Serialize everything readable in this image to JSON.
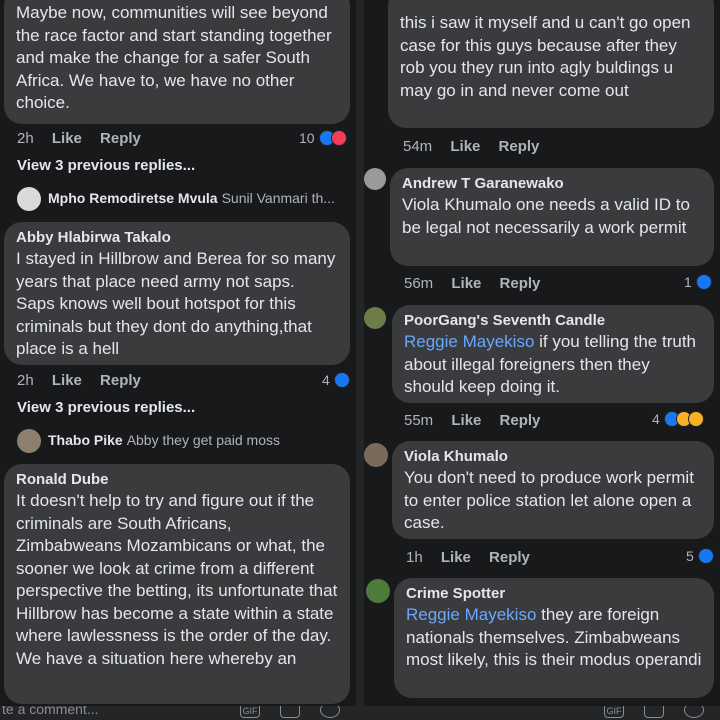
{
  "left": {
    "c1": {
      "text": "Maybe now, communities will see beyond the race factor and start standing together and make the change for a safer South Africa. We have to, we have no other choice.",
      "time": "2h",
      "like": "Like",
      "reply": "Reply",
      "count": "10",
      "view_replies": "View 3 previous replies...",
      "reply_name": "Mpho Remodiretse Mvula",
      "reply_text": "Sunil Vanmari th..."
    },
    "c2": {
      "name": "Abby Hlabirwa Takalo",
      "text": "I stayed in Hillbrow and Berea for so many years that place need army not saps. Saps knows well bout hotspot for this criminals but they dont do anything,that place is a hell",
      "time": "2h",
      "like": "Like",
      "reply": "Reply",
      "count": "4",
      "view_replies": "View 3 previous replies...",
      "reply_name": "Thabo Pike",
      "reply_text": "Abby they get paid moss"
    },
    "c3": {
      "name": "Ronald Dube",
      "text": "It doesn't help to try and figure out if the criminals are South Africans, Zimbabweans Mozambicans or what, the sooner we look at crime from a different perspective the betting, its unfortunate that Hillbrow has become a state within a state where lawlessness is the order of the day.",
      "text2": "We have a situation here whereby an"
    },
    "composer_placeholder": "te a comment..."
  },
  "right": {
    "c1": {
      "text": "this i saw it myself and u can't go open case for this guys because after they rob you they run into agly buldings u may go in and never come out",
      "time": "54m",
      "like": "Like",
      "reply": "Reply"
    },
    "c2": {
      "name": "Andrew T Garanewako",
      "text": "Viola Khumalo one needs a valid ID to be legal not necessarily a work permit",
      "time": "56m",
      "like": "Like",
      "reply": "Reply",
      "count": "1"
    },
    "c3": {
      "name": "PoorGang's Seventh Candle",
      "mention": "Reggie Mayekiso",
      "text": " if you telling the truth about illegal foreigners then they should keep doing it.",
      "time": "55m",
      "like": "Like",
      "reply": "Reply",
      "count": "4"
    },
    "c4": {
      "name": "Viola Khumalo",
      "text": "You don't need to produce work permit to enter police station let alone open a case.",
      "time": "1h",
      "like": "Like",
      "reply": "Reply",
      "count": "5"
    },
    "c5": {
      "name": "Crime Spotter",
      "mention": "Reggie Mayekiso",
      "text": " they are foreign nationals themselves. Zimbabweans most likely, this is their modus operandi"
    }
  },
  "colors": {
    "bubble": "#3a3b3c",
    "bg": "#18191a",
    "mention": "#6aa7ff",
    "like": "#1877f2",
    "love": "#f33e58",
    "wow": "#f7b125"
  }
}
